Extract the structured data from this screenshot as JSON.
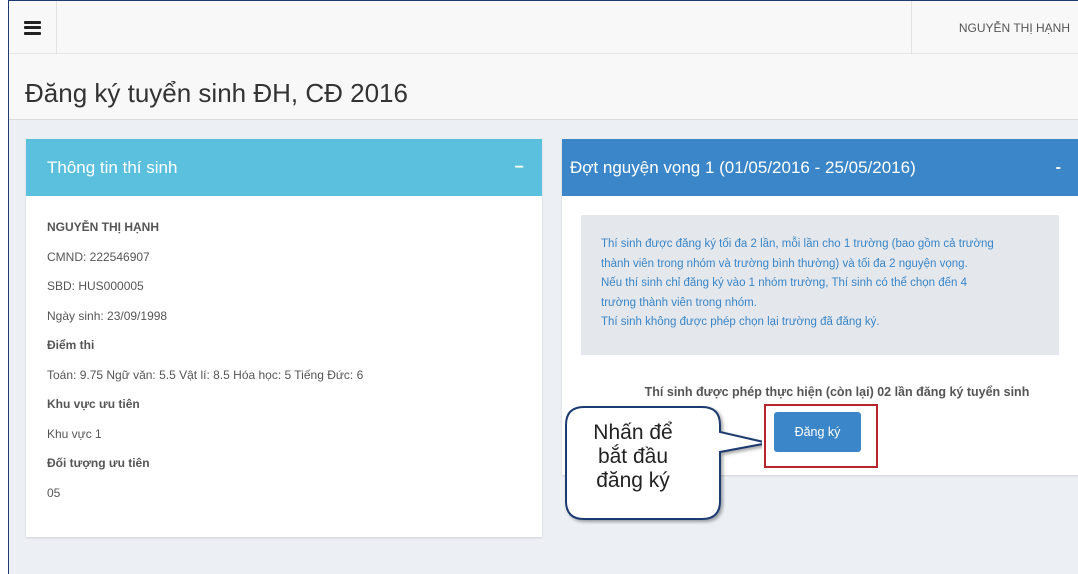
{
  "header": {
    "user_name": "NGUYỄN THỊ HẠNH",
    "page_title": "Đăng ký tuyển sinh ĐH, CĐ 2016"
  },
  "student_panel": {
    "title": "Thông tin thí sinh",
    "collapse_label": "−",
    "name": "NGUYỄN THỊ HẠNH",
    "id_card": "CMND: 222546907",
    "candidate_no": "SBD: HUS000005",
    "birth_date": "Ngày sinh: 23/09/1998",
    "scores_heading": "Điểm thi",
    "scores": "Toán: 9.75 Ngữ văn: 5.5 Vật lí: 8.5 Hóa học: 5 Tiếng Đức: 6",
    "region_heading": "Khu vực ưu tiên",
    "region": "Khu vực 1",
    "group_heading": "Đối tượng ưu tiên",
    "group": "05"
  },
  "round_panel": {
    "title": "Đợt nguyện vọng 1 (01/05/2016 - 25/05/2016)",
    "collapse_label": "-",
    "notice_lines": [
      "Thí sinh được đăng ký tối đa 2 lần, mỗi lần cho 1 trường (bao gồm cả trường",
      "thành viên trong nhóm và trường bình thường) và tối đa 2 nguyện vọng.",
      "Nếu thí sinh chỉ đăng ký vào 1 nhóm trường, Thí sinh có thể chọn đến 4",
      "trường thành viên trong nhóm.",
      "Thí sinh không được phép chọn lại trường đã đăng ký."
    ],
    "attempts_text": "Thí sinh được phép thực hiện (còn lại) 02 lần đăng ký tuyển sinh",
    "register_label": "Đăng ký"
  },
  "callout": {
    "lines": [
      "Nhấn để",
      "bắt đầu",
      "đăng ký"
    ]
  },
  "colors": {
    "info_header": "#5bc0de",
    "primary": "#3a86c8",
    "highlight": "#b5272a",
    "page_bg": "#ecf0f5"
  },
  "icons": {
    "menu": "hamburger-icon"
  }
}
